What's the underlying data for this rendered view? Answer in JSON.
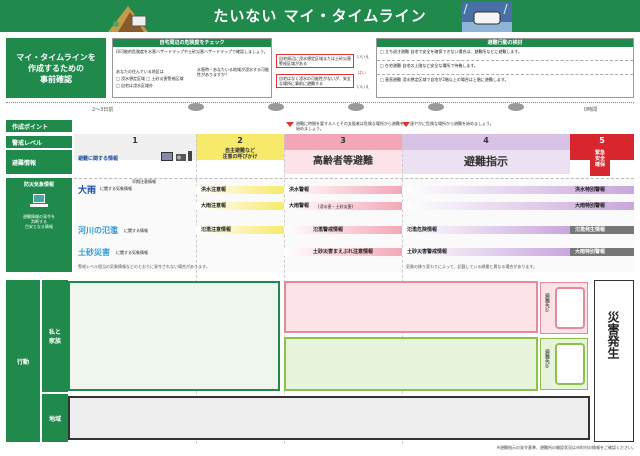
{
  "header": {
    "title": "たいない マイ・タイムライン"
  },
  "prep": {
    "label": "マイ・タイムラインを\n作成するための\n事前確認",
    "hazard_title": "自宅周辺の危険度をチェック",
    "hazard_intro": "印可能的危険度を水害ハザードマップや土砂災害ハザードマップで確認しましょう。",
    "hazard_q1": "あなたの住んでいる地区は",
    "hazard_opt1": "□ 浸水想定区域  □ 土砂災害警戒区域",
    "hazard_opt2": "□ 自宅は浸水区域外",
    "hazard_note": "水害時・あなたいる地域が浸水する可能性がありますか？",
    "check_text1": "自宅周辺に浸水想定区域または土砂災害警戒区域がある",
    "check_text2": "自宅はなく浸水の可能性がないが、安全な場所に事前に避難する",
    "yes1": "いいえ",
    "yes2": "はい",
    "yes3": "いいえ",
    "evac_title": "避難行動の検討",
    "evac_text1": "□ 立ち退き避難  自宅で安全を確保できない場合は、避難所などに避難します。",
    "evac_text2": "□ 在宅避難  自宅の上階など安全な場所で待機します。",
    "evac_text3": "□ 垂直避難  浸水想定区域で自宅が2階以上の場合は上階に避難します。"
  },
  "timeline": {
    "start": "2～3日前",
    "end": "0時間"
  },
  "rows": {
    "points_label": "作成ポイント",
    "point1": "避難に時間を要する人とその支援者は危険な場所から避難を始めましょう。",
    "point2": "速やかに危険な場所から避難を始めましょう。",
    "level_label": "警戒レベル",
    "evac_info_label": "避難情報",
    "weather_label": "防災気象情報",
    "weather_sub": "避難情報の発令を\n判断する\n目安となる情報",
    "action_label": "行動",
    "family_label": "私と\n家族",
    "area_label": "地域"
  },
  "levels": [
    {
      "num": "1",
      "text": ""
    },
    {
      "num": "2",
      "text": "自主避難など\n注意の呼びかけ"
    },
    {
      "num": "3",
      "text": "高齢者等避難"
    },
    {
      "num": "4",
      "text": "避難指示"
    },
    {
      "num": "5",
      "text": "緊急\n安全\n確保"
    }
  ],
  "evac_info": {
    "item1": "避難に関する情報"
  },
  "weather": {
    "heavy_rain": "大雨",
    "heavy_rain_sub": "に関する気象情報",
    "early_warn": "早期注意情報",
    "flood_adv": "洪水注意報",
    "rain_adv": "大雨注意報",
    "flood_warn": "洪水警報",
    "rain_warn": "大雨警報",
    "rain_warn_sub": "(浸水害・土砂災害)",
    "flood_special": "洪水特別警報",
    "rain_special": "大雨特別警報",
    "river": "河川の氾濫",
    "river_sub": "に関する情報",
    "river_1": "氾濫注意情報",
    "river_2": "氾濫警戒情報",
    "river_3": "氾濫危険情報",
    "river_4": "氾濫発生情報",
    "landslide": "土砂災害",
    "landslide_sub": "に関する気象情報",
    "land_1": "土砂災害まえぶれ注意情報",
    "land_2": "土砂災害警戒情報",
    "land_3": "大雨特別警報",
    "note1": "警戒レベル相当の気象情報などのとおりに発令されない場合があります。",
    "note2": "気象の移り変わりによって、記載している順番と異なる場合があります。"
  },
  "action": {
    "evac_point1": "避難先①",
    "evac_point2": "避難先②",
    "disaster": "災害発生",
    "footnote": "※避難指示の発令基準、避難所の開設状況は市町村の情報をご確認ください。"
  },
  "colors": {
    "brand_green": "#1f8a4c",
    "level2": "#f7ea6b",
    "level3": "#f3a7b6",
    "level4": "#c9a6dc",
    "level5": "#d8262f"
  }
}
